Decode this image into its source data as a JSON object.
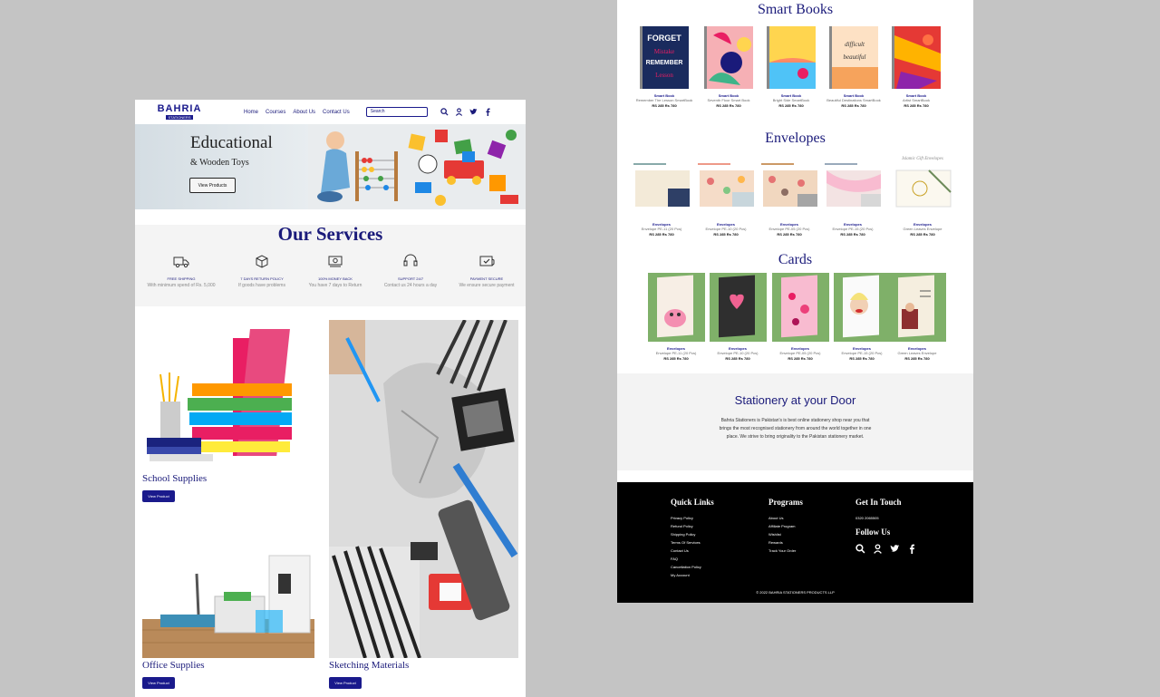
{
  "left": {
    "nav": {
      "logo": "BAHRIA",
      "logo_sub": "STATIONERS",
      "links": [
        "Home",
        "Courses",
        "About Us",
        "Contact Us"
      ],
      "search_placeholder": "Search"
    },
    "hero": {
      "title": "Educational",
      "subtitle": "& Wooden Toys",
      "button": "View Products"
    },
    "services": {
      "title": "Our Services",
      "items": [
        {
          "title": "FREE SHIPPING",
          "desc": "With minimum spend of Rs. 5,000",
          "icon": "truck-icon"
        },
        {
          "title": "7 DAYS RETURN POLICY",
          "desc": "If goods have problems",
          "icon": "return-box-icon"
        },
        {
          "title": "100% MONEY BACK",
          "desc": "You have 7 days to Return",
          "icon": "money-back-icon"
        },
        {
          "title": "SUPPORT 24/7",
          "desc": "Contact us 24 hours a day",
          "icon": "headset-icon"
        },
        {
          "title": "PAYMENT SECURE",
          "desc": "We ensure secure payment",
          "icon": "secure-payment-icon"
        }
      ]
    },
    "tiles": [
      {
        "label": "School Supplies",
        "button": "View Product"
      },
      {
        "label": "Sketching Materials",
        "button": "View Product"
      },
      {
        "label": "Office Supplies",
        "button": "View Product"
      }
    ]
  },
  "right": {
    "smart_books": {
      "title": "Smart Books",
      "items": [
        {
          "name": "Smart Book",
          "desc": "Remember The Lesson SmartBook",
          "price": "RS 285 Rs 780"
        },
        {
          "name": "Smart Book",
          "desc": "Seventh Floor Smart Book",
          "price": "RS 285 Rs 780"
        },
        {
          "name": "Smart Book",
          "desc": "Bright Side SmartBook",
          "price": "RS 285 Rs 780"
        },
        {
          "name": "Smart Book",
          "desc": "Beautiful Destinations SmartBook",
          "price": "RS 285 Rs 780"
        },
        {
          "name": "Smart Book",
          "desc": "Artist SmartBook",
          "price": "RS 285 Rs 780"
        }
      ]
    },
    "envelopes": {
      "title": "Envelopes",
      "items": [
        {
          "name": "Envelopes",
          "desc": "Envelope PE-11 (20 Pcs)",
          "price": "RS 285 Rs 780"
        },
        {
          "name": "Envelopes",
          "desc": "Envelope PE-10 (20 Pcs)",
          "price": "RS 285 Rs 780"
        },
        {
          "name": "Envelopes",
          "desc": "Envelope PE-05 (20 Pcs)",
          "price": "RS 285 Rs 780"
        },
        {
          "name": "Envelopes",
          "desc": "Envelope PE-15 (20 Pcs)",
          "price": "RS 285 Rs 780"
        },
        {
          "name": "Envelopes",
          "desc": "Green Leaves Envelope",
          "price": "RS 285 Rs 780"
        }
      ]
    },
    "cards": {
      "title": "Cards",
      "items": [
        {
          "name": "Envelopes",
          "desc": "Envelope PE-11 (20 Pcs)",
          "price": "RS 285 Rs 780"
        },
        {
          "name": "Envelopes",
          "desc": "Envelope PE-10 (20 Pcs)",
          "price": "RS 285 Rs 780"
        },
        {
          "name": "Envelopes",
          "desc": "Envelope PE-05 (20 Pcs)",
          "price": "RS 285 Rs 780"
        },
        {
          "name": "Envelopes",
          "desc": "Envelope PE-15 (20 Pcs)",
          "price": "RS 285 Rs 780"
        },
        {
          "name": "Envelopes",
          "desc": "Green Leaves Envelope",
          "price": "RS 285 Rs 780"
        }
      ]
    },
    "door": {
      "title": "Stationery at your Door",
      "text": "Bahria Stationers is Pakistan's is best online stationery shop near you that brings the most recognised stationery from around the world together in one place. We strive to bring originality to the Pakistan stationery market."
    },
    "footer": {
      "quick_links_title": "Quick Links",
      "quick_links": [
        "Privacy Policy",
        "Refund Policy",
        "Shipping Policy",
        "Terms Of Services",
        "Contact Us",
        "FAQ",
        "Cancellation Policy",
        "My Account"
      ],
      "programs_title": "Programs",
      "programs": [
        "About Us",
        "Affiliate Program",
        "Wishlist",
        "Rewards",
        "Track Your Order"
      ],
      "touch_title": "Get In Touch",
      "phone": "0320 2065505",
      "follow_title": "Follow Us",
      "copyright": "© 2022 BAHRIA STATIONERS PRODUCTS LLP"
    }
  }
}
